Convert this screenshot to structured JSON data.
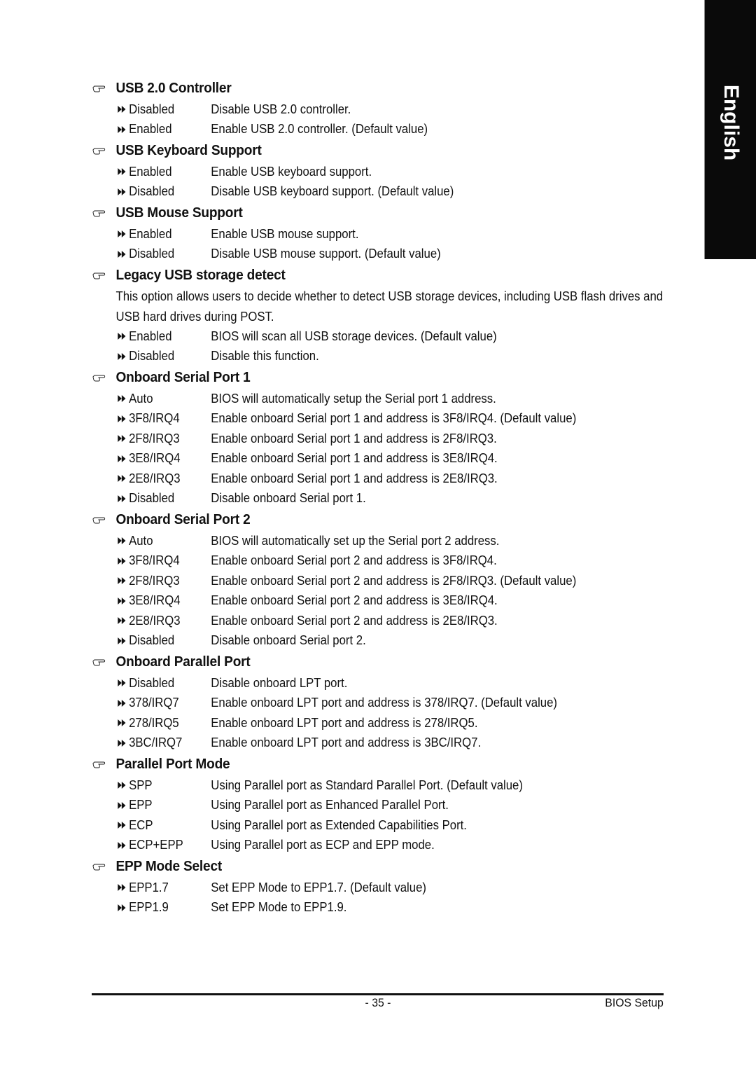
{
  "language_tab": "English",
  "sections": [
    {
      "title": "USB 2.0 Controller",
      "options": [
        {
          "option": "Disabled",
          "description": "Disable USB 2.0 controller."
        },
        {
          "option": "Enabled",
          "description": "Enable USB 2.0 controller. (Default value)"
        }
      ]
    },
    {
      "title": "USB Keyboard Support",
      "options": [
        {
          "option": "Enabled",
          "description": "Enable USB keyboard support."
        },
        {
          "option": "Disabled",
          "description": "Disable USB keyboard support. (Default value)"
        }
      ]
    },
    {
      "title": "USB Mouse Support",
      "options": [
        {
          "option": "Enabled",
          "description": "Enable USB mouse support."
        },
        {
          "option": "Disabled",
          "description": "Disable USB mouse support. (Default value)"
        }
      ]
    },
    {
      "title": "Legacy USB storage detect",
      "paragraph": "This option allows users to decide whether to detect USB storage devices, including USB flash drives and USB hard drives during POST.",
      "options": [
        {
          "option": "Enabled",
          "description": "BIOS will scan all USB storage devices. (Default value)"
        },
        {
          "option": "Disabled",
          "description": "Disable this function."
        }
      ]
    },
    {
      "title": "Onboard Serial Port 1",
      "options": [
        {
          "option": "Auto",
          "description": "BIOS will automatically setup the Serial port 1 address."
        },
        {
          "option": "3F8/IRQ4",
          "description": "Enable onboard Serial port 1 and address is 3F8/IRQ4. (Default value)"
        },
        {
          "option": "2F8/IRQ3",
          "description": "Enable onboard Serial port 1 and address is 2F8/IRQ3."
        },
        {
          "option": "3E8/IRQ4",
          "description": "Enable onboard Serial port 1 and address is 3E8/IRQ4."
        },
        {
          "option": "2E8/IRQ3",
          "description": "Enable onboard Serial port 1 and address is 2E8/IRQ3."
        },
        {
          "option": "Disabled",
          "description": "Disable onboard Serial port 1."
        }
      ]
    },
    {
      "title": "Onboard Serial Port 2",
      "options": [
        {
          "option": "Auto",
          "description": "BIOS will automatically set up the  Serial port 2 address."
        },
        {
          "option": "3F8/IRQ4",
          "description": "Enable onboard Serial port 2 and address is 3F8/IRQ4."
        },
        {
          "option": "2F8/IRQ3",
          "description": "Enable onboard Serial port 2 and address is 2F8/IRQ3. (Default value)"
        },
        {
          "option": "3E8/IRQ4",
          "description": "Enable onboard Serial port 2 and address is 3E8/IRQ4."
        },
        {
          "option": "2E8/IRQ3",
          "description": "Enable onboard Serial port 2 and address is 2E8/IRQ3."
        },
        {
          "option": "Disabled",
          "description": "Disable onboard Serial port 2."
        }
      ]
    },
    {
      "title": "Onboard Parallel Port",
      "options": [
        {
          "option": "Disabled",
          "description": "Disable onboard LPT port."
        },
        {
          "option": "378/IRQ7",
          "description": "Enable onboard LPT port and address is 378/IRQ7. (Default value)"
        },
        {
          "option": "278/IRQ5",
          "description": "Enable onboard LPT port and address is 278/IRQ5."
        },
        {
          "option": "3BC/IRQ7",
          "description": "Enable onboard LPT port and address is 3BC/IRQ7."
        }
      ]
    },
    {
      "title": "Parallel Port Mode",
      "options": [
        {
          "option": "SPP",
          "description": "Using Parallel port as Standard Parallel Port. (Default value)"
        },
        {
          "option": "EPP",
          "description": "Using Parallel port as Enhanced Parallel Port."
        },
        {
          "option": "ECP",
          "description": "Using Parallel port as Extended Capabilities Port."
        },
        {
          "option": "ECP+EPP",
          "description": "Using Parallel port as ECP and EPP mode."
        }
      ]
    },
    {
      "title": "EPP Mode Select",
      "options": [
        {
          "option": "EPP1.7",
          "description": "Set EPP Mode to EPP1.7. (Default value)"
        },
        {
          "option": "EPP1.9",
          "description": "Set EPP Mode to EPP1.9."
        }
      ]
    }
  ],
  "footer": {
    "page_number": "- 35 -",
    "chapter": "BIOS Setup"
  }
}
